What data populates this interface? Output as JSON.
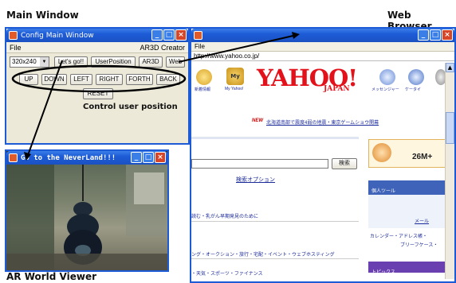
{
  "captions": {
    "main_window": "Main Window",
    "web_browser": "Web Browser",
    "control": "Control user position",
    "ar_world": "AR World Viewer"
  },
  "main_window": {
    "title": "Config Main Window",
    "menu_file": "File",
    "app_name": "AR3D Creator",
    "resolution": "320x240",
    "buttons_row1": [
      "Let's go!!",
      "UserPosition",
      "AR3D",
      "Web"
    ],
    "buttons_row2": [
      "UP",
      "DOWN",
      "LEFT",
      "RIGHT",
      "FORTH",
      "BACK"
    ],
    "reset": "RESET"
  },
  "ar_window": {
    "title": "Go to the NeverLand!!!"
  },
  "browser": {
    "title": "",
    "menu_file": "File",
    "url": "http://www.yahoo.co.jp/",
    "logo_main": "YAHOO!",
    "logo_sub": "JAPAN",
    "nav_labels": [
      "新着情報",
      "My Yahoo!",
      "メッセンジャー",
      "ケータイ"
    ],
    "news_badge": "NEW",
    "news_line": "北海道南部で震度4弱の地震・東京ゲームショウ開幕",
    "search_button": "検索",
    "search_option": "検索オプション",
    "link_line1": "読む・乳がん早期発見のために",
    "link_line2": "ング・オークション・旅行・宅配・イベント・ウェブホスティング",
    "link_line3": "・天気・スポーツ・ファイナンス",
    "ad_text": "26M+",
    "sidebar_header1": "個人ツール",
    "sidebar_mail": "メール",
    "sidebar_links": "カレンダー・アドレス帳・",
    "sidebar_links2": "ブリーフケース・",
    "sidebar_header2": "トピックス"
  }
}
